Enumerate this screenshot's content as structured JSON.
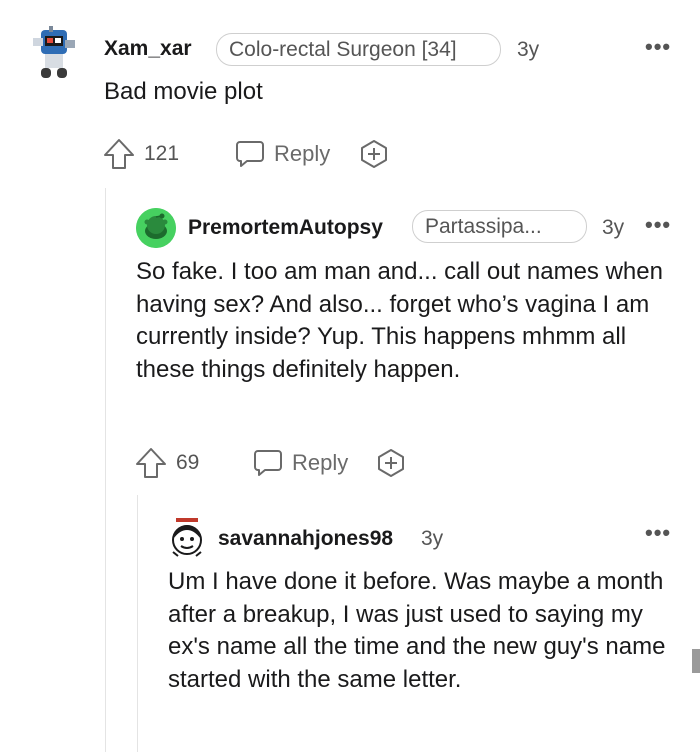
{
  "comments": [
    {
      "username": "Xam_xar",
      "flair": "Colo-rectal Surgeon [34]",
      "age": "3y",
      "body": "Bad movie plot",
      "votes": "121",
      "reply_label": "Reply",
      "more": "•••"
    },
    {
      "username": "PremortemAutopsy",
      "flair": "Partassipa...",
      "age": "3y",
      "body": "So fake. I too am man and... call out names when having sex? And also... forget who’s vagina I am currently inside? Yup. This happens mhmm all these things definitely happen.",
      "votes": "69",
      "reply_label": "Reply",
      "more": "•••"
    },
    {
      "username": "savannahjones98",
      "age": "3y",
      "body": "Um I have done it before. Was maybe a month after a breakup, I was just used to saying my ex's name all the time and the new guy's name started with the same letter.",
      "more": "•••"
    }
  ],
  "colors": {
    "text": "#1a1a1b",
    "muted": "#555555",
    "thread_line": "#e4e4e4",
    "snoo_green": "#46d160"
  },
  "icons": [
    "upvote-icon",
    "comment-bubble-icon",
    "award-plus-icon",
    "more-options-icon"
  ]
}
